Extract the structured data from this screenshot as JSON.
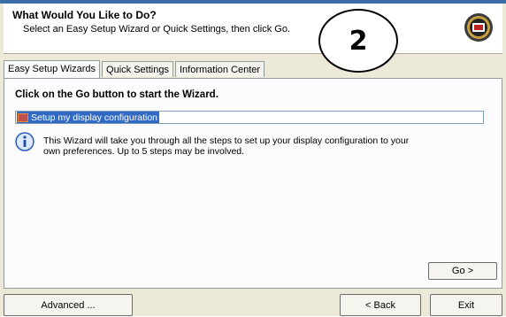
{
  "header": {
    "title": "What Would You Like to Do?",
    "subtitle": "Select an Easy Setup Wizard or Quick Settings, then click Go.",
    "step_badge": "2"
  },
  "tabs": [
    {
      "label": "Easy Setup Wizards",
      "active": true
    },
    {
      "label": "Quick Settings",
      "active": false
    },
    {
      "label": "Information Center",
      "active": false
    }
  ],
  "panel": {
    "heading": "Click on the Go button to start the Wizard.",
    "wizard_list": [
      {
        "label": "Setup my display configuration",
        "selected": true
      }
    ],
    "info_text": "This Wizard will take you through all the steps to set up your display configuration to your own preferences. Up to 5 steps may be involved.",
    "go_label": "Go >"
  },
  "footer": {
    "advanced_label": "Advanced ...",
    "back_label": "< Back",
    "exit_label": "Exit"
  },
  "colors": {
    "selection": "#316ac5",
    "dialog_bg": "#ece9d8",
    "panel_bg": "#fcfcfe"
  }
}
